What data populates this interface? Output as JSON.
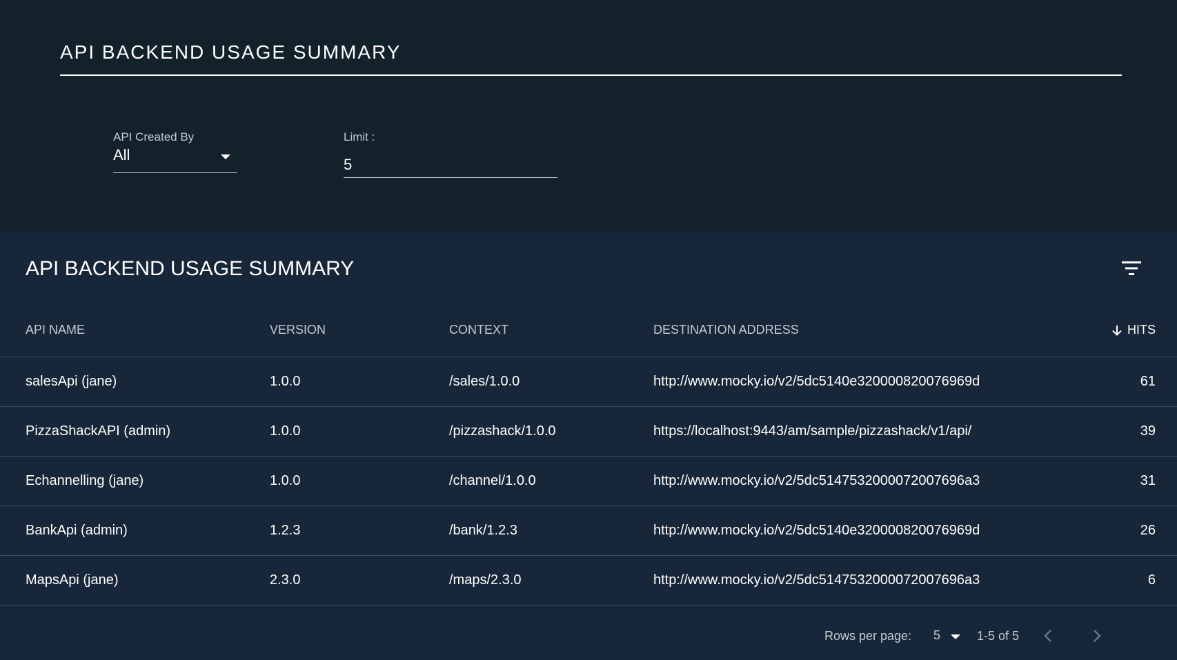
{
  "header": {
    "title": "API BACKEND USAGE SUMMARY"
  },
  "filters": {
    "created_by_label": "API Created By",
    "created_by_value": "All",
    "limit_label": "Limit :",
    "limit_value": "5"
  },
  "table": {
    "title": "API BACKEND USAGE SUMMARY",
    "columns": {
      "api_name": "API NAME",
      "version": "VERSION",
      "context": "CONTEXT",
      "destination": "DESTINATION ADDRESS",
      "hits": "HITS"
    },
    "rows": [
      {
        "api_name": "salesApi (jane)",
        "version": "1.0.0",
        "context": "/sales/1.0.0",
        "destination": "http://www.mocky.io/v2/5dc5140e320000820076969d",
        "hits": "61"
      },
      {
        "api_name": "PizzaShackAPI (admin)",
        "version": "1.0.0",
        "context": "/pizzashack/1.0.0",
        "destination": "https://localhost:9443/am/sample/pizzashack/v1/api/",
        "hits": "39"
      },
      {
        "api_name": "Echannelling (jane)",
        "version": "1.0.0",
        "context": "/channel/1.0.0",
        "destination": "http://www.mocky.io/v2/5dc5147532000072007696a3",
        "hits": "31"
      },
      {
        "api_name": "BankApi (admin)",
        "version": "1.2.3",
        "context": "/bank/1.2.3",
        "destination": "http://www.mocky.io/v2/5dc5140e320000820076969d",
        "hits": "26"
      },
      {
        "api_name": "MapsApi (jane)",
        "version": "2.3.0",
        "context": "/maps/2.3.0",
        "destination": "http://www.mocky.io/v2/5dc5147532000072007696a3",
        "hits": "6"
      }
    ]
  },
  "pagination": {
    "rows_per_page_label": "Rows per page:",
    "rows_per_page_value": "5",
    "range": "1-5 of 5"
  },
  "icons": {
    "filter": "filter-list-icon",
    "sort": "arrow-down-icon",
    "prev": "chevron-left-icon",
    "next": "chevron-right-icon"
  },
  "colors": {
    "background": "#13212b",
    "card": "#172638",
    "divider": "#39485a",
    "muted_text": "#c4cbd1"
  }
}
